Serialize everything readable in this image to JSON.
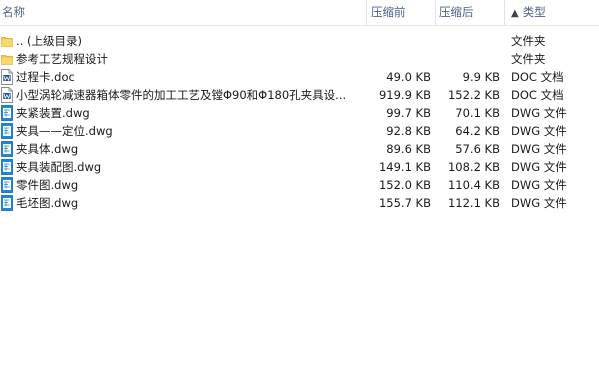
{
  "header": {
    "name": "名称",
    "packed": "压缩前",
    "size": "压缩后",
    "type_arrow": "▲",
    "type": "类型"
  },
  "rows": [
    {
      "icon": "folder-icon",
      "name": ".. (上级目录)",
      "packed": "",
      "size": "",
      "type": "文件夹"
    },
    {
      "icon": "folder-icon",
      "name": "参考工艺规程设计",
      "packed": "",
      "size": "",
      "type": "文件夹"
    },
    {
      "icon": "doc-file-icon",
      "name": "过程卡.doc",
      "packed": "49.0 KB",
      "size": "9.9 KB",
      "type": "DOC 文档"
    },
    {
      "icon": "doc-file-icon",
      "name": "小型涡轮减速器箱体零件的加工工艺及镗Φ90和Φ180孔夹具设...",
      "packed": "919.9 KB",
      "size": "152.2 KB",
      "type": "DOC 文档"
    },
    {
      "icon": "dwg-file-icon",
      "name": "夹紧装置.dwg",
      "packed": "99.7 KB",
      "size": "70.1 KB",
      "type": "DWG 文件"
    },
    {
      "icon": "dwg-file-icon",
      "name": "夹具——定位.dwg",
      "packed": "92.8 KB",
      "size": "64.2 KB",
      "type": "DWG 文件"
    },
    {
      "icon": "dwg-file-icon",
      "name": "夹具体.dwg",
      "packed": "89.6 KB",
      "size": "57.6 KB",
      "type": "DWG 文件"
    },
    {
      "icon": "dwg-file-icon",
      "name": "夹具装配图.dwg",
      "packed": "149.1 KB",
      "size": "108.2 KB",
      "type": "DWG 文件"
    },
    {
      "icon": "dwg-file-icon",
      "name": "零件图.dwg",
      "packed": "152.0 KB",
      "size": "110.4 KB",
      "type": "DWG 文件"
    },
    {
      "icon": "dwg-file-icon",
      "name": "毛坯图.dwg",
      "packed": "155.7 KB",
      "size": "112.1 KB",
      "type": "DWG 文件"
    }
  ]
}
